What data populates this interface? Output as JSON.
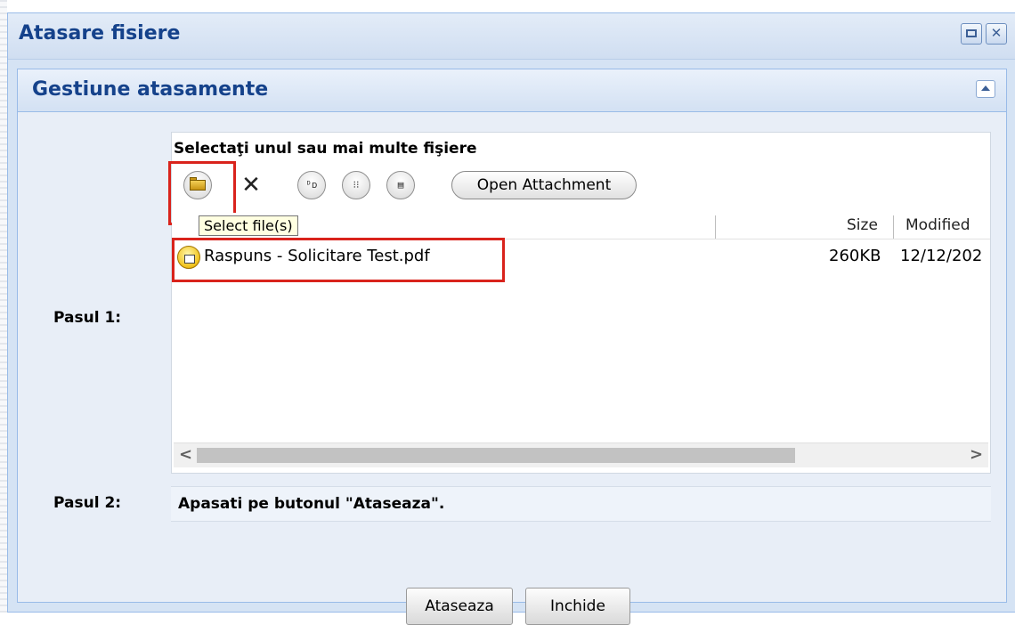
{
  "dialog": {
    "title": "Atasare fisiere"
  },
  "panel": {
    "title": "Gestiune atasamente"
  },
  "step1": {
    "label": "Pasul 1:"
  },
  "uploader": {
    "heading": "Selectaţi unul sau mai multe fişiere",
    "tooltip": "Select file(s)",
    "open_attachment_label": "Open Attachment",
    "columns": {
      "name": "",
      "size": "Size",
      "modified": "Modified"
    },
    "file": {
      "name": "Raspuns - Solicitare Test.pdf",
      "size": "260KB",
      "modified": "12/12/202"
    },
    "view_icons": {
      "detail": "ᴰᴅ",
      "list": "⁝⁝",
      "tile": "▤"
    }
  },
  "step2": {
    "label": "Pasul 2:",
    "text": "Apasati pe butonul \"Ataseaza\"."
  },
  "footer": {
    "attach_label": "Ataseaza",
    "close_label": "Inchide"
  },
  "scrollbar": {
    "left": "<",
    "right": ">"
  },
  "colors": {
    "title_text": "#15428b",
    "highlight": "#d9231c",
    "tooltip_bg": "#ffffe1"
  }
}
